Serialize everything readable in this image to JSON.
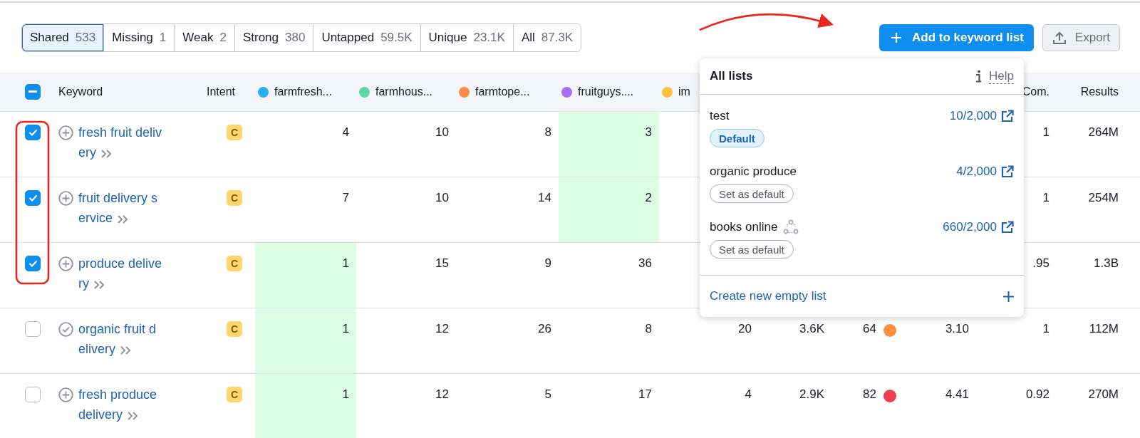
{
  "toolbar": {
    "tabs": [
      {
        "label": "Shared",
        "count": "533",
        "selected": true
      },
      {
        "label": "Missing",
        "count": "1",
        "selected": false
      },
      {
        "label": "Weak",
        "count": "2",
        "selected": false
      },
      {
        "label": "Strong",
        "count": "380",
        "selected": false
      },
      {
        "label": "Untapped",
        "count": "59.5K",
        "selected": false
      },
      {
        "label": "Unique",
        "count": "23.1K",
        "selected": false
      },
      {
        "label": "All",
        "count": "87.3K",
        "selected": false
      }
    ],
    "add_button": "Add to keyword list",
    "export_button": "Export"
  },
  "table": {
    "select_all": {
      "indeterminate": true
    },
    "columns": [
      {
        "label": "Keyword"
      },
      {
        "label": "Intent"
      },
      {
        "label": "farmfresh...",
        "color": "#2aaef5"
      },
      {
        "label": "farmhous...",
        "color": "#5bd8a6"
      },
      {
        "label": "farmtope...",
        "color": "#fb8c46"
      },
      {
        "label": "fruitguys....",
        "color": "#a66ef2"
      },
      {
        "label": "im",
        "color": "#fcc13b"
      },
      null,
      null,
      null,
      {
        "label": "Com."
      },
      {
        "label": "Results"
      }
    ],
    "rows": [
      {
        "checked": true,
        "added": false,
        "keyword": "fresh fruit delivery",
        "intent": "C",
        "cells": [
          {
            "text": "4",
            "highlighted": false
          },
          {
            "text": "10",
            "highlighted": false
          },
          {
            "text": "8",
            "highlighted": false
          },
          {
            "text": "3",
            "highlighted": true
          },
          null,
          null,
          null,
          null,
          {
            "text": "1"
          },
          {
            "text": "264M"
          }
        ]
      },
      {
        "checked": true,
        "added": false,
        "keyword": "fruit delivery service",
        "intent": "C",
        "cells": [
          {
            "text": "7",
            "highlighted": false
          },
          {
            "text": "10",
            "highlighted": false
          },
          {
            "text": "14",
            "highlighted": false
          },
          {
            "text": "2",
            "highlighted": true
          },
          null,
          null,
          null,
          null,
          {
            "text": "1"
          },
          {
            "text": "254M"
          }
        ]
      },
      {
        "checked": true,
        "added": false,
        "keyword": "produce delivery",
        "intent": "C",
        "cells": [
          {
            "text": "1",
            "highlighted": true
          },
          {
            "text": "15",
            "highlighted": false
          },
          {
            "text": "9",
            "highlighted": false
          },
          {
            "text": "36",
            "highlighted": false
          },
          null,
          null,
          null,
          null,
          {
            "text": ".95"
          },
          {
            "text": "1.3B"
          }
        ]
      },
      {
        "checked": false,
        "added": true,
        "keyword": "organic fruit delivery",
        "intent": "C",
        "cells": [
          {
            "text": "1",
            "highlighted": true
          },
          {
            "text": "12",
            "highlighted": false
          },
          {
            "text": "26",
            "highlighted": false
          },
          {
            "text": "8",
            "highlighted": false
          },
          {
            "text": "20",
            "highlighted": false
          },
          {
            "text": "3.6K"
          },
          {
            "text": "64",
            "color": "#f7913f"
          },
          {
            "text": "3.10"
          },
          {
            "text": "1"
          },
          {
            "text": "112M"
          }
        ]
      },
      {
        "checked": false,
        "added": false,
        "keyword": "fresh produce delivery",
        "intent": "C",
        "cells": [
          {
            "text": "1",
            "highlighted": true
          },
          {
            "text": "12",
            "highlighted": false
          },
          {
            "text": "5",
            "highlighted": false
          },
          {
            "text": "17",
            "highlighted": false
          },
          {
            "text": "4",
            "highlighted": false
          },
          {
            "text": "2.9K"
          },
          {
            "text": "82",
            "color": "#f03e4e"
          },
          {
            "text": "4.41"
          },
          {
            "text": "0.92"
          },
          {
            "text": "270M"
          }
        ]
      }
    ]
  },
  "popup": {
    "title": "All lists",
    "help": "Help",
    "lists": [
      {
        "name": "test",
        "count": "10/2,000",
        "default": true,
        "badge": "Default",
        "shared": false
      },
      {
        "name": "organic produce",
        "count": "4/2,000",
        "default": false,
        "badge": "Set as default",
        "shared": false
      },
      {
        "name": "books online",
        "count": "660/2,000",
        "default": false,
        "badge": "Set as default",
        "shared": true
      }
    ],
    "create": "Create new empty list"
  }
}
